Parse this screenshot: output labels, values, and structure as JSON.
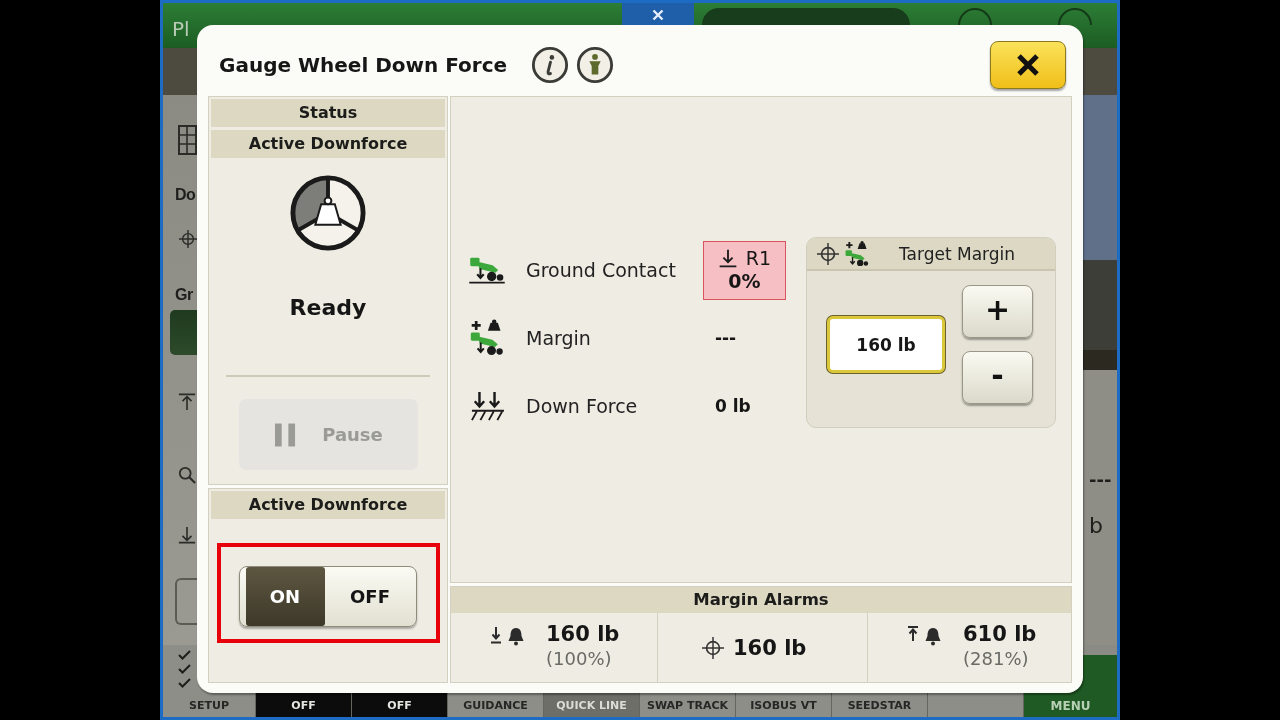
{
  "background": {
    "title": "Pl",
    "left_labels": [
      "Do",
      "Gr"
    ],
    "right_labels": [
      "---",
      "b"
    ],
    "softkeys": [
      {
        "label": "SETUP",
        "kind": "checklist",
        "disabled": false
      },
      {
        "label": "OFF",
        "kind": "dark",
        "disabled": false
      },
      {
        "label": "OFF",
        "kind": "dark",
        "disabled": false
      },
      {
        "label": "GUIDANCE",
        "kind": "plain",
        "disabled": false
      },
      {
        "label": "QUICK LINE",
        "kind": "plain",
        "disabled": true
      },
      {
        "label": "SWAP TRACK",
        "kind": "plain",
        "disabled": false
      },
      {
        "label": "ISOBUS VT",
        "kind": "plain",
        "disabled": false
      },
      {
        "label": "SEEDSTAR",
        "kind": "plain",
        "disabled": false
      },
      {
        "kind": "blank"
      },
      {
        "label": "MENU",
        "kind": "menu",
        "disabled": false
      }
    ]
  },
  "dialog": {
    "title": "Gauge Wheel Down Force",
    "status_panel": {
      "header": "Status",
      "subheader": "Active Downforce",
      "state": "Ready",
      "pause_button": {
        "label": "Pause",
        "disabled": true
      }
    },
    "control_panel": {
      "header": "Active Downforce",
      "toggle": {
        "highlighted": true,
        "options": [
          {
            "label": "ON",
            "selected": true
          },
          {
            "label": "OFF",
            "selected": false
          }
        ]
      }
    },
    "readings": [
      {
        "kind": "ground_contact",
        "label": "Ground Contact",
        "status": {
          "row": "R1",
          "value": "0%",
          "alert": true
        }
      },
      {
        "kind": "margin",
        "label": "Margin",
        "value": "---"
      },
      {
        "kind": "down_force",
        "label": "Down Force",
        "value": "0 lb"
      }
    ],
    "target_margin": {
      "title": "Target Margin",
      "value": "160 lb",
      "buttons": [
        "+",
        "-"
      ]
    },
    "margin_alarms": {
      "title": "Margin Alarms",
      "items": [
        {
          "kind": "low",
          "value": "160 lb",
          "percent": "(100%)"
        },
        {
          "kind": "target",
          "value": "160 lb"
        },
        {
          "kind": "high",
          "value": "610 lb",
          "percent": "(281%)"
        }
      ]
    }
  }
}
